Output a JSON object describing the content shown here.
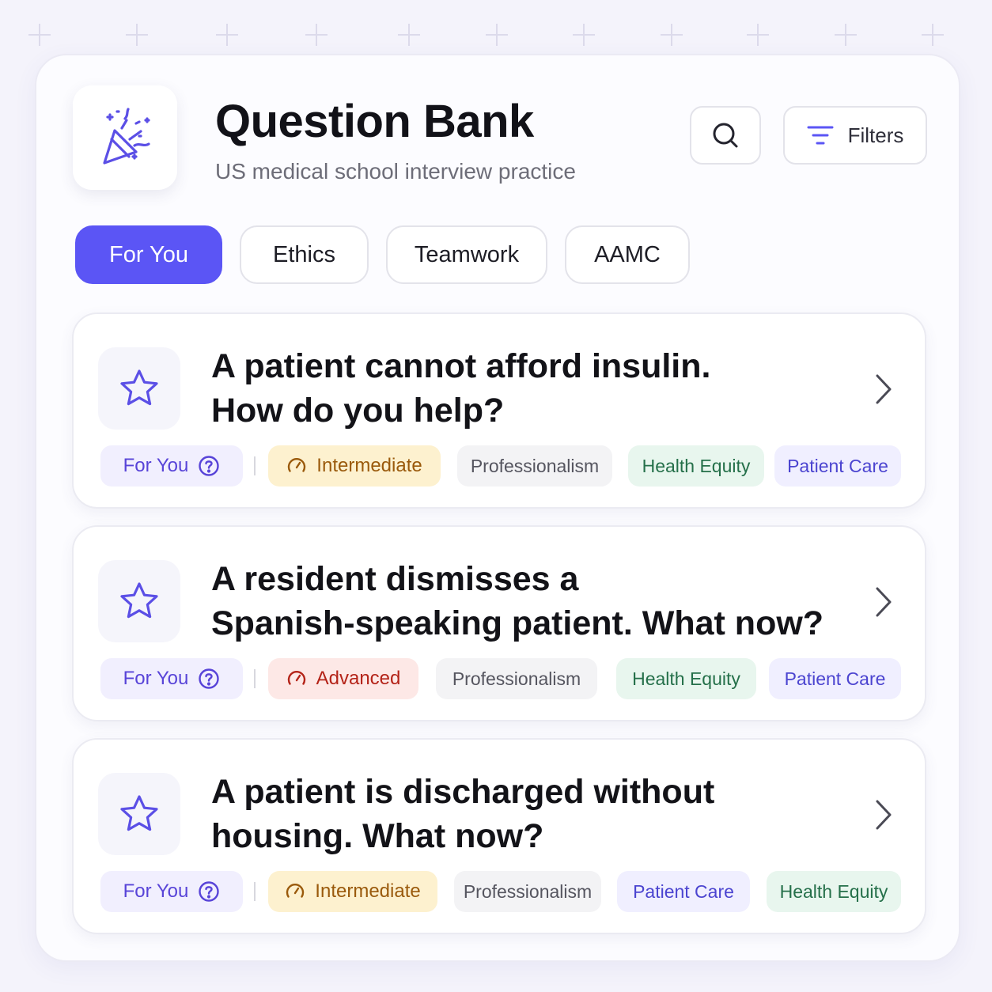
{
  "app": {
    "title": "Question Bank",
    "subtitle": "US medical school interview practice",
    "logo_icon": "party-popper-icon",
    "accent_color": "#5b55f5"
  },
  "toolbar": {
    "search_icon": "search-icon",
    "filters_label": "Filters",
    "filters_icon": "filter-lines-icon"
  },
  "tabs": [
    {
      "label": "For You",
      "active": true
    },
    {
      "label": "Ethics",
      "active": false
    },
    {
      "label": "Teamwork",
      "active": false
    },
    {
      "label": "AAMC",
      "active": false
    }
  ],
  "questions": [
    {
      "text": "A patient cannot afford insulin.\nHow do you help?",
      "for_you_label": "For You",
      "difficulty": "Intermediate",
      "tags": [
        "Professionalism",
        "Health Equity",
        "Patient Care"
      ]
    },
    {
      "text": "A resident dismisses a\nSpanish-speaking patient. What now?",
      "for_you_label": "For You",
      "difficulty": "Advanced",
      "tags": [
        "Professionalism",
        "Health Equity",
        "Patient Care"
      ]
    },
    {
      "text": "A patient is discharged without\nhousing. What now?",
      "for_you_label": "For You",
      "difficulty": "Intermediate",
      "tags": [
        "Professionalism",
        "Patient Care",
        "Health Equity"
      ]
    }
  ],
  "colors": {
    "intermediate_bg": "#fdf1cf",
    "intermediate_text": "#9a5a0c",
    "advanced_bg": "#fde8e6",
    "advanced_text": "#b42318",
    "health_equity_text": "#25704a",
    "patient_care_text": "#4b44d0"
  }
}
